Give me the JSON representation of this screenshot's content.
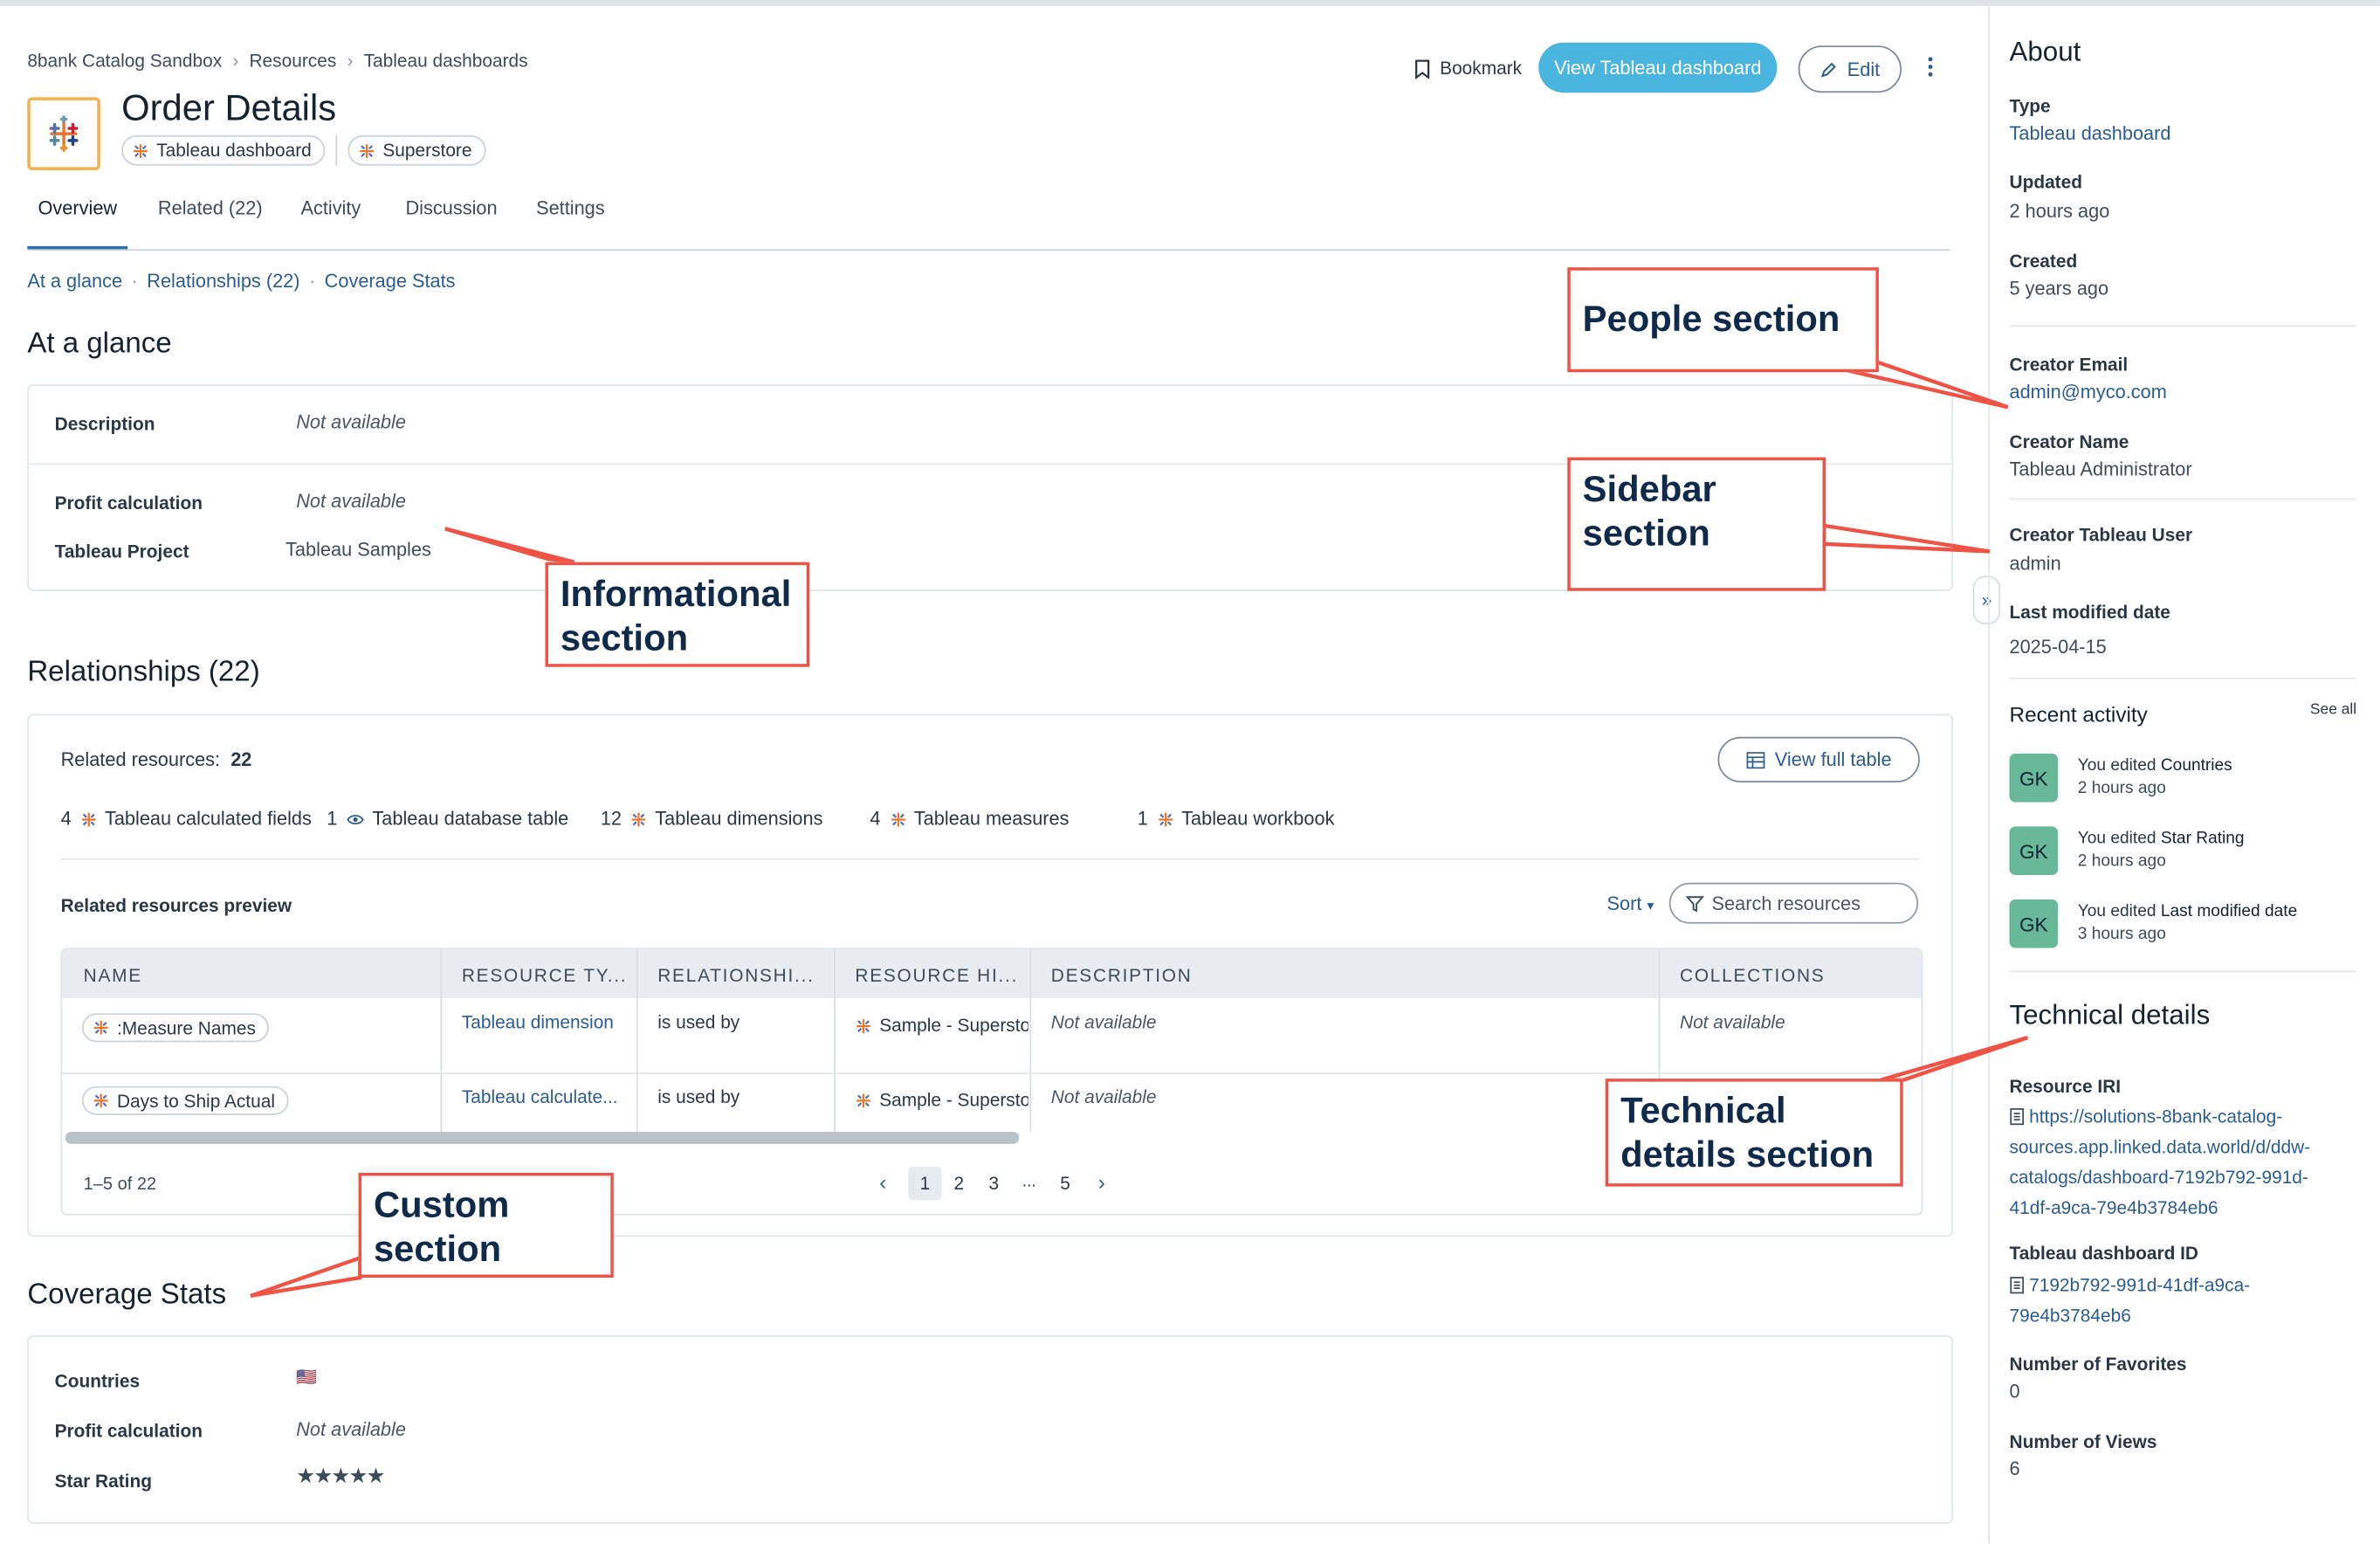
{
  "breadcrumb": [
    "8bank Catalog Sandbox",
    "Resources",
    "Tableau dashboards"
  ],
  "header": {
    "title": "Order Details",
    "chips": [
      "Tableau dashboard",
      "Superstore"
    ],
    "bookmark_label": "Bookmark",
    "primary_button": "View Tableau dashboard",
    "edit_label": "Edit",
    "more_icon": "kebab-menu-icon"
  },
  "tabs": [
    "Overview",
    "Related (22)",
    "Activity",
    "Discussion",
    "Settings"
  ],
  "anchors": [
    "At a glance",
    "Relationships (22)",
    "Coverage Stats"
  ],
  "at_a_glance": {
    "heading": "At a glance",
    "rows": [
      {
        "label": "Description",
        "value": "Not available"
      },
      {
        "label": "Profit calculation",
        "value": "Not available"
      },
      {
        "label": "Tableau Project",
        "value": "Tableau Samples"
      }
    ]
  },
  "relationships": {
    "heading": "Relationships (22)",
    "related_label": "Related resources:",
    "related_count": "22",
    "view_full_table": "View full table",
    "counts": [
      {
        "count": "4",
        "label": "Tableau calculated fields"
      },
      {
        "count": "1",
        "label": "Tableau database table"
      },
      {
        "count": "12",
        "label": "Tableau dimensions"
      },
      {
        "count": "4",
        "label": "Tableau measures"
      },
      {
        "count": "1",
        "label": "Tableau workbook"
      }
    ],
    "preview_label": "Related resources preview",
    "sort_label": "Sort",
    "search_placeholder": "Search resources",
    "columns": [
      "NAME",
      "RESOURCE TY...",
      "RELATIONSHI...",
      "RESOURCE HI...",
      "DESCRIPTION",
      "COLLECTIONS"
    ],
    "rows": [
      {
        "name": ":Measure Names",
        "type": "Tableau dimension",
        "relationship": "is used by",
        "hierarchy": "Sample - Superstore",
        "description": "Not available",
        "collections": "Not available"
      },
      {
        "name": "Days to Ship Actual",
        "type": "Tableau calculate...",
        "relationship": "is used by",
        "hierarchy": "Sample - Superstore",
        "description": "Not available",
        "collections": ""
      }
    ],
    "range_label": "1–5 of 22",
    "pages": [
      "1",
      "2",
      "3",
      "...",
      "5"
    ]
  },
  "coverage": {
    "heading": "Coverage Stats",
    "rows": [
      {
        "label": "Countries",
        "value": "🇺🇸"
      },
      {
        "label": "Profit calculation",
        "value": "Not available"
      },
      {
        "label": "Star Rating",
        "value": "★★★★★"
      }
    ],
    "star_rating": 5
  },
  "sidebar": {
    "about_heading": "About",
    "type_label": "Type",
    "type_value": "Tableau dashboard",
    "updated_label": "Updated",
    "updated_value": "2 hours ago",
    "created_label": "Created",
    "created_value": "5 years ago",
    "creator_email_label": "Creator Email",
    "creator_email_value": "admin@myco.com",
    "creator_name_label": "Creator Name",
    "creator_name_value": "Tableau Administrator",
    "creator_user_label": "Creator Tableau User",
    "creator_user_value": "admin",
    "last_modified_label": "Last modified date",
    "last_modified_value": "2025-04-15",
    "recent_activity_heading": "Recent activity",
    "see_all": "See all",
    "activity": [
      {
        "avatar": "GK",
        "prefix": "You edited ",
        "target": "Countries",
        "time": "2 hours ago"
      },
      {
        "avatar": "GK",
        "prefix": "You edited ",
        "target": "Star Rating",
        "time": "2 hours ago"
      },
      {
        "avatar": "GK",
        "prefix": "You edited ",
        "target": "Last modified date",
        "time": "3 hours ago"
      }
    ],
    "tech_heading": "Technical details",
    "iri_label": "Resource IRI",
    "iri_lines": [
      "https://solutions-8bank-catalog-",
      "sources.app.linked.data.world/d/ddw-",
      "catalogs/dashboard-7192b792-991d-",
      "41df-a9ca-79e4b3784eb6"
    ],
    "dash_id_label": "Tableau dashboard ID",
    "dash_id_lines": [
      "7192b792-991d-41df-a9ca-",
      "79e4b3784eb6"
    ],
    "favorites_label": "Number of Favorites",
    "favorites_value": "0",
    "views_label": "Number of Views",
    "views_value": "6"
  },
  "callouts": {
    "people": "People section",
    "sidebar": "Sidebar section",
    "informational": "Informational section",
    "custom": "Custom section",
    "technical": "Technical details section"
  },
  "colors": {
    "accent": "#4ab6e0",
    "link": "#2a5d8f",
    "callout": "#ee5346",
    "avatar": "#67b99a"
  }
}
